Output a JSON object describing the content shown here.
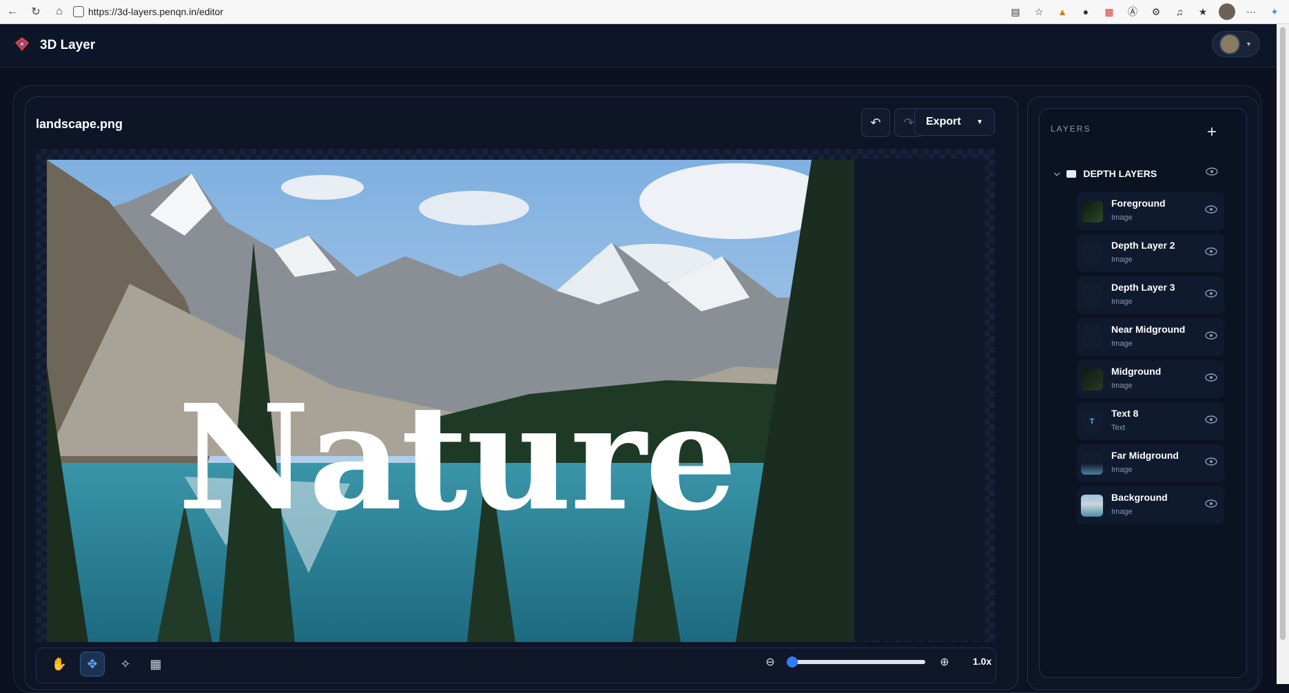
{
  "browser": {
    "url": "https://3d-layers.penqn.in/editor",
    "nav_icons": [
      "back-icon",
      "reload-icon",
      "home-icon"
    ],
    "ext_icons": [
      "reader-icon",
      "star-icon",
      "metamask-icon",
      "extension-icon",
      "calendar-icon",
      "a-icon",
      "puzzle-icon",
      "music-icon",
      "favorites-icon",
      "profile-icon",
      "more-icon",
      "copilot-icon"
    ]
  },
  "app": {
    "brand": "3D Layer"
  },
  "editor": {
    "file_name": "landscape.png",
    "export_label": "Export",
    "canvas_text": "Nature",
    "zoom_label": "1.0x",
    "zoom_level": 0.0
  },
  "layers_panel": {
    "title": "LAYERS",
    "group_label": "DEPTH LAYERS",
    "items": [
      {
        "name": "Foreground",
        "type": "Image"
      },
      {
        "name": "Depth Layer 2",
        "type": "Image"
      },
      {
        "name": "Depth Layer 3",
        "type": "Image"
      },
      {
        "name": "Near Midground",
        "type": "Image"
      },
      {
        "name": "Midground",
        "type": "Image"
      },
      {
        "name": "Text 8",
        "type": "Text"
      },
      {
        "name": "Far Midground",
        "type": "Image"
      },
      {
        "name": "Background",
        "type": "Image"
      }
    ]
  },
  "colors": {
    "accent": "#2f7cf6",
    "background": "#0b1120"
  }
}
